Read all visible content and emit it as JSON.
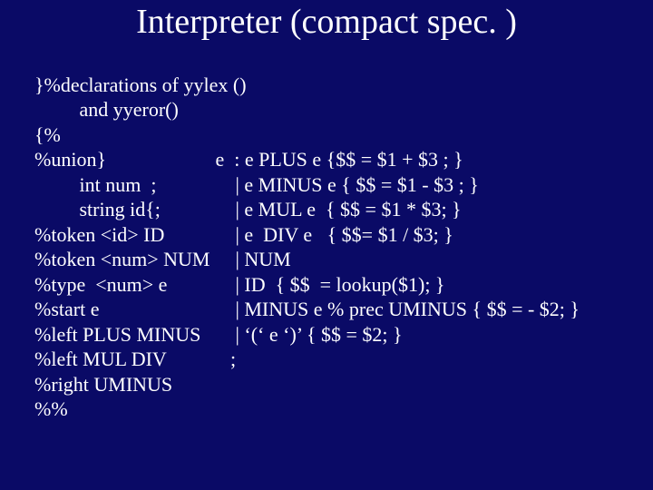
{
  "title": "Interpreter (compact spec. )",
  "left": {
    "l1": "}%declarations of yylex ()",
    "l2": "         and yyeror()",
    "l3": "{%",
    "l4": "%union}",
    "l5": "         int num  ;",
    "l6": "         string id{;",
    "l7": "%token <id> ID",
    "l8": "%token <num> NUM",
    "l9": "%type  <num> e",
    "l10": "%start e",
    "l11": "%left PLUS MINUS",
    "l12": "%left MUL DIV",
    "l13": "%right UMINUS",
    "l14": "%%"
  },
  "right": {
    "r1": "e  : e PLUS e {$$ = $1 + $3 ; }",
    "r2": "    | e MINUS e { $$ = $1 - $3 ; }",
    "r3": "    | e MUL e  { $$ = $1 * $3; }",
    "r4": "    | e  DIV e   { $$= $1 / $3; }",
    "r5": "    | NUM",
    "r6": "    | ID  { $$  = lookup($1); }",
    "r7": "    | MINUS e % prec UMINUS { $$ = - $2; }",
    "r8": "    | ‘(‘ e ‘)’ { $$ = $2; }",
    "r9": "   ;"
  }
}
